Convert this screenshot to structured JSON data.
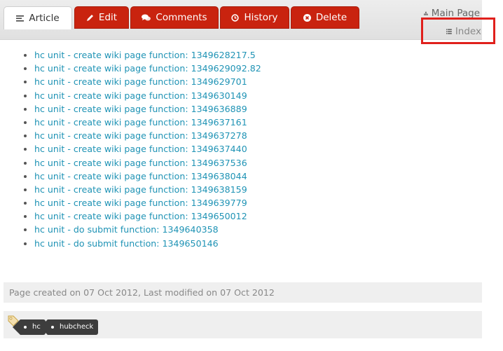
{
  "tabs": [
    {
      "label": "Article",
      "icon": "document-icon",
      "active": true
    },
    {
      "label": "Edit",
      "icon": "pencil-icon"
    },
    {
      "label": "Comments",
      "icon": "comments-icon"
    },
    {
      "label": "History",
      "icon": "clock-icon"
    },
    {
      "label": "Delete",
      "icon": "delete-circle-icon"
    }
  ],
  "sidebar": {
    "main_page": "Main Page",
    "index": "Index"
  },
  "pages": [
    "hc unit - create wiki page function: 1349628217.5",
    "hc unit - create wiki page function: 1349629092.82",
    "hc unit - create wiki page function: 1349629701",
    "hc unit - create wiki page function: 1349630149",
    "hc unit - create wiki page function: 1349636889",
    "hc unit - create wiki page function: 1349637161",
    "hc unit - create wiki page function: 1349637278",
    "hc unit - create wiki page function: 1349637440",
    "hc unit - create wiki page function: 1349637536",
    "hc unit - create wiki page function: 1349638044",
    "hc unit - create wiki page function: 1349638159",
    "hc unit - create wiki page function: 1349639779",
    "hc unit - create wiki page function: 1349650012",
    "hc unit - do submit function: 1349640358",
    "hc unit - do submit function: 1349650146"
  ],
  "meta": "Page created on 07 Oct 2012, Last modified on 07 Oct 2012",
  "tags": [
    "hc",
    "hubcheck"
  ],
  "colors": {
    "tab_red": "#c9230f",
    "link": "#1f93b5",
    "highlight": "#e0201c"
  }
}
